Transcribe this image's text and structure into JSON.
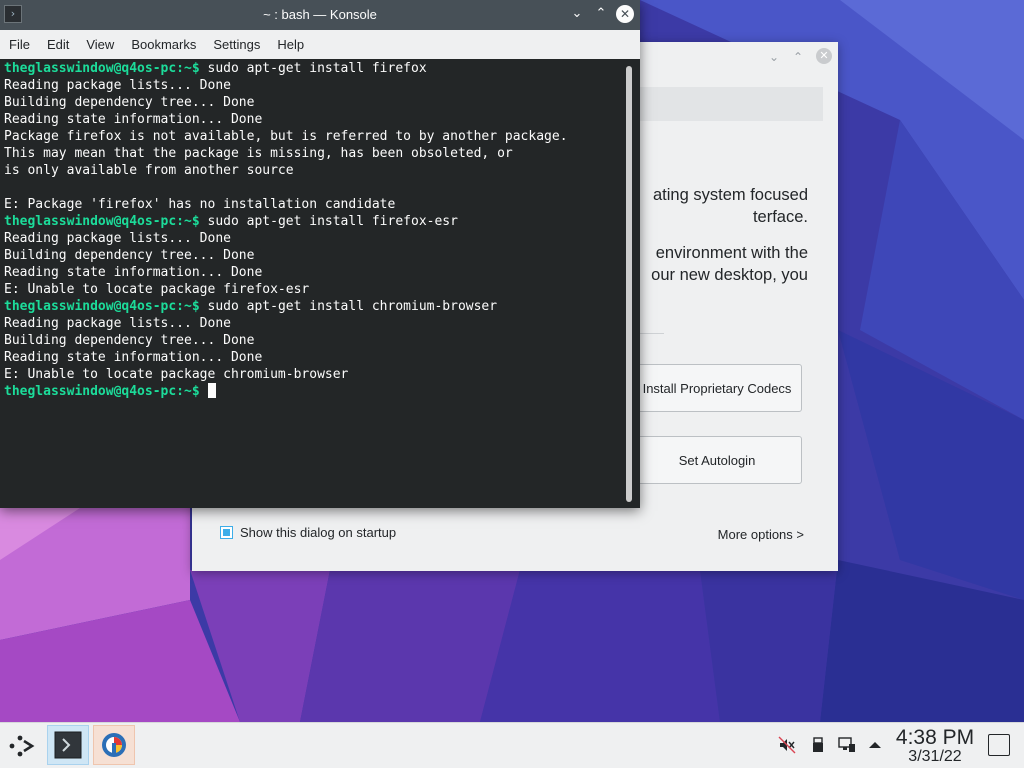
{
  "konsole": {
    "title": "~ : bash — Konsole",
    "menu": [
      "File",
      "Edit",
      "View",
      "Bookmarks",
      "Settings",
      "Help"
    ],
    "lines": [
      {
        "prompt": "theglasswindow@q4os-pc:~$",
        "text": " sudo apt-get install firefox"
      },
      {
        "prompt": "",
        "text": "Reading package lists... Done"
      },
      {
        "prompt": "",
        "text": "Building dependency tree... Done"
      },
      {
        "prompt": "",
        "text": "Reading state information... Done"
      },
      {
        "prompt": "",
        "text": "Package firefox is not available, but is referred to by another package."
      },
      {
        "prompt": "",
        "text": "This may mean that the package is missing, has been obsoleted, or"
      },
      {
        "prompt": "",
        "text": "is only available from another source"
      },
      {
        "prompt": "",
        "text": ""
      },
      {
        "prompt": "",
        "text": "E: Package 'firefox' has no installation candidate"
      },
      {
        "prompt": "theglasswindow@q4os-pc:~$",
        "text": " sudo apt-get install firefox-esr"
      },
      {
        "prompt": "",
        "text": "Reading package lists... Done"
      },
      {
        "prompt": "",
        "text": "Building dependency tree... Done"
      },
      {
        "prompt": "",
        "text": "Reading state information... Done"
      },
      {
        "prompt": "",
        "text": "E: Unable to locate package firefox-esr"
      },
      {
        "prompt": "theglasswindow@q4os-pc:~$",
        "text": " sudo apt-get install chromium-browser"
      },
      {
        "prompt": "",
        "text": "Reading package lists... Done"
      },
      {
        "prompt": "",
        "text": "Building dependency tree... Done"
      },
      {
        "prompt": "",
        "text": "Reading state information... Done"
      },
      {
        "prompt": "",
        "text": "E: Unable to locate package chromium-browser"
      },
      {
        "prompt": "theglasswindow@q4os-pc:~$",
        "text": " ",
        "cursor": true
      }
    ]
  },
  "welcome": {
    "intro_lines": [
      "ating system focused",
      "terface.",
      "",
      "environment with the",
      "our new desktop, you"
    ],
    "codecs_label": "Install Proprietary Codecs",
    "autologin_label": "Set Autologin",
    "startup_label": "Show this dialog on startup",
    "startup_checked": true,
    "more_options_label": "More options >"
  },
  "taskbar": {
    "time": "4:38 PM",
    "date": "3/31/22",
    "tray_icons": [
      "volume-muted-icon",
      "usb-icon",
      "network-icon",
      "tray-expand-icon"
    ]
  },
  "colors": {
    "prompt": "#1cdc9a",
    "terminal_bg": "#232627",
    "titlebar": "#475057",
    "accent": "#3daee9"
  }
}
